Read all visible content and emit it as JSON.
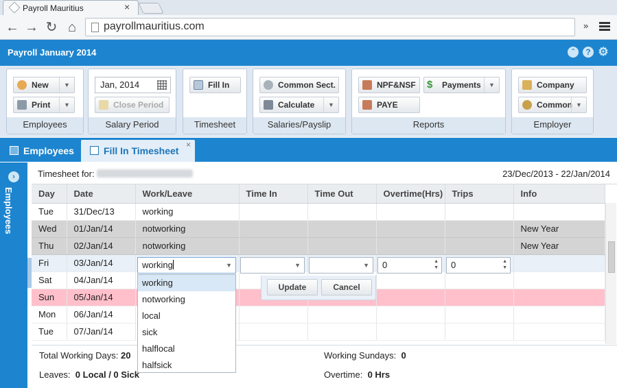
{
  "browser": {
    "tab_title": "Payroll Mauritius",
    "tab_close": "×",
    "url": "payrollmauritius.com",
    "ext_label": "»"
  },
  "app": {
    "title": "Payroll January 2014"
  },
  "ribbon": {
    "employees": {
      "label": "Employees",
      "new": "New",
      "print": "Print"
    },
    "salary_period": {
      "label": "Salary Period",
      "date_value": "Jan, 2014",
      "close_period": "Close Period"
    },
    "timesheet": {
      "label": "Timesheet",
      "fill_in": "Fill In"
    },
    "salaries": {
      "label": "Salaries/Payslip",
      "common_sect": "Common Sect.",
      "calculate": "Calculate"
    },
    "reports": {
      "label": "Reports",
      "npf": "NPF&NSF",
      "payments": "Payments",
      "paye": "PAYE"
    },
    "employer": {
      "label": "Employer",
      "company": "Company",
      "common": "Common"
    }
  },
  "tabs": {
    "employees": "Employees",
    "fill_in_timesheet": "Fill In Timesheet",
    "close": "×"
  },
  "side_panel": {
    "label": "Employees"
  },
  "timesheet": {
    "for_label": "Timesheet for:",
    "range": "23/Dec/2013 - 22/Jan/2014",
    "columns": [
      "Day",
      "Date",
      "Work/Leave",
      "Time In",
      "Time Out",
      "Overtime(Hrs)",
      "Trips",
      "Info"
    ],
    "rows": [
      {
        "day": "Tue",
        "date": "31/Dec/13",
        "work": "working",
        "info": ""
      },
      {
        "day": "Wed",
        "date": "01/Jan/14",
        "work": "notworking",
        "info": "New Year"
      },
      {
        "day": "Thu",
        "date": "02/Jan/14",
        "work": "notworking",
        "info": "New Year"
      },
      {
        "day": "Fri",
        "date": "03/Jan/14",
        "work": "",
        "info": ""
      },
      {
        "day": "Sat",
        "date": "04/Jan/14",
        "work": "",
        "info": ""
      },
      {
        "day": "Sun",
        "date": "05/Jan/14",
        "work": "",
        "info": ""
      },
      {
        "day": "Mon",
        "date": "06/Jan/14",
        "work": "",
        "info": ""
      },
      {
        "day": "Tue",
        "date": "07/Jan/14",
        "work": "",
        "info": ""
      }
    ],
    "editor": {
      "work_value": "working",
      "overtime_value": "0",
      "trips_value": "0",
      "options": [
        "working",
        "notworking",
        "local",
        "sick",
        "halflocal",
        "halfsick"
      ],
      "update": "Update",
      "cancel": "Cancel"
    }
  },
  "footer": {
    "total_working_days_label": "Total Working Days:",
    "total_working_days": "20",
    "leaves_label": "Leaves:",
    "leaves_value": "0 Local / 0 Sick",
    "working_sundays_label": "Working Sundays:",
    "working_sundays": "0",
    "overtime_label": "Overtime:",
    "overtime_value": "0 Hrs"
  }
}
